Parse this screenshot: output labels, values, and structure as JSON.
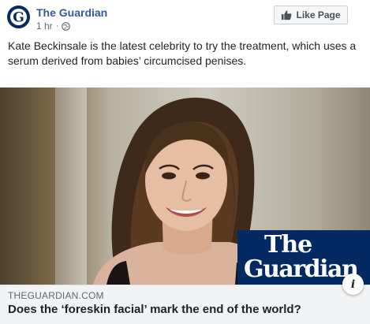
{
  "page": {
    "name": "The Guardian",
    "time": "1 hr",
    "separator": "·",
    "privacy_icon": "globe-icon"
  },
  "actions": {
    "like_page_label": "Like Page",
    "like_icon": "thumbs-up-icon"
  },
  "post": {
    "text": "Kate Beckinsale is the latest celebrity to try the treatment, which uses a serum derived from babies’ circumcised penises."
  },
  "image": {
    "logo_line1": "The",
    "logo_line2": "Guardian",
    "info_label": "i"
  },
  "link": {
    "domain": "THEGUARDIAN.COM",
    "headline": "Does the ‘foreskin facial’ mark the end of the world?"
  },
  "colors": {
    "brand_blue": "#385898",
    "guardian_navy": "#052962",
    "footer_bg": "#f2f3f5"
  }
}
